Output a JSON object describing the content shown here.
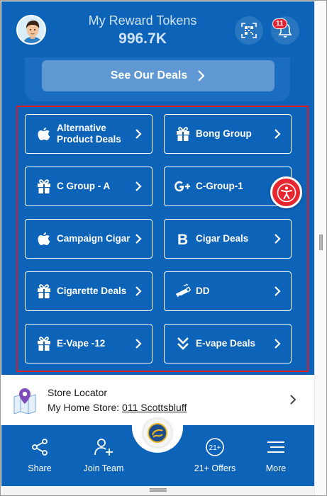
{
  "header": {
    "title": "My Reward Tokens",
    "value": "996.7K",
    "notification_count": "11"
  },
  "deals_button": {
    "label": "See Our Deals"
  },
  "deal_cards": [
    {
      "label": "Alternative Product Deals",
      "icon": "apple-icon"
    },
    {
      "label": "Bong Group",
      "icon": "gift-icon"
    },
    {
      "label": "C Group - A",
      "icon": "gift-icon"
    },
    {
      "label": "C-Group-1",
      "icon": "google-plus-icon"
    },
    {
      "label": "Campaign Cigar",
      "icon": "apple-icon"
    },
    {
      "label": "Cigar Deals",
      "icon": "letter-b-icon"
    },
    {
      "label": "Cigarette Deals",
      "icon": "gift-icon"
    },
    {
      "label": "DD",
      "icon": "vape-pen-icon"
    },
    {
      "label": "E-Vape -12",
      "icon": "gift-icon"
    },
    {
      "label": "E-vape Deals",
      "icon": "double-chevron-down-icon"
    }
  ],
  "store": {
    "title": "Store Locator",
    "home_label": "My Home Store:",
    "home_link": "011 Scottsbluff"
  },
  "nav": [
    {
      "label": "Share",
      "icon": "share-icon"
    },
    {
      "label": "Join Team",
      "icon": "add-user-icon"
    },
    {
      "label": "21+ Offers",
      "icon": "age-21-icon"
    },
    {
      "label": "More",
      "icon": "menu-icon"
    }
  ],
  "colors": {
    "primary_blue": "#0c63b8",
    "accent_red": "#e01b24",
    "button_blue": "#5f98d3"
  }
}
